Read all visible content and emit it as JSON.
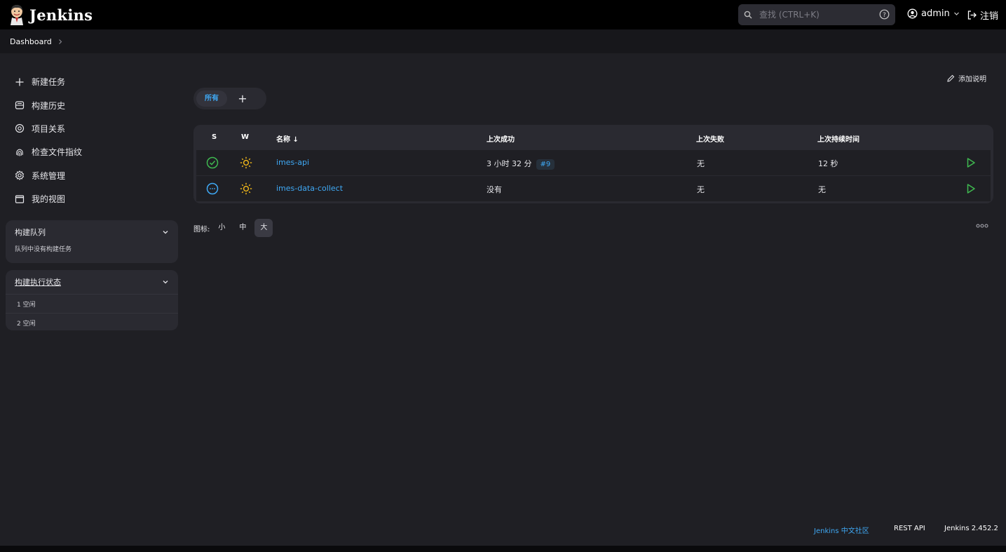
{
  "header": {
    "logo_text": "Jenkins",
    "search_placeholder": "查找 (CTRL+K)",
    "user": "admin",
    "logout": "注销"
  },
  "breadcrumb": {
    "items": [
      "Dashboard"
    ]
  },
  "nav": {
    "items": [
      {
        "label": "新建任务",
        "icon": "plus-icon"
      },
      {
        "label": "构建历史",
        "icon": "history-icon"
      },
      {
        "label": "项目关系",
        "icon": "relations-icon"
      },
      {
        "label": "检查文件指纹",
        "icon": "fingerprint-icon"
      },
      {
        "label": "系统管理",
        "icon": "gear-icon"
      },
      {
        "label": "我的视图",
        "icon": "window-icon"
      }
    ]
  },
  "build_queue": {
    "title": "构建队列",
    "empty_text": "队列中没有构建任务"
  },
  "executors": {
    "title": "构建执行状态",
    "rows": [
      "1  空闲",
      "2  空闲"
    ]
  },
  "main": {
    "add_description": "添加说明",
    "views": {
      "active": "所有",
      "add_label": "+"
    },
    "table": {
      "columns": {
        "s": "S",
        "w": "W",
        "name": "名称 ↓",
        "last_success": "上次成功",
        "last_failure": "上次失败",
        "last_duration": "上次持续时间"
      },
      "rows": [
        {
          "status": "success",
          "weather": "sunny",
          "name": "imes-api",
          "last_success": "3 小时 32 分",
          "build": "#9",
          "last_failure": "无",
          "duration": "12 秒"
        },
        {
          "status": "not-built",
          "weather": "sunny",
          "name": "imes-data-collect",
          "last_success": "没有",
          "build": "",
          "last_failure": "无",
          "duration": "无"
        }
      ]
    },
    "icon_size": {
      "label": "图标:",
      "options": [
        "小",
        "中",
        "大"
      ],
      "selected": "大"
    }
  },
  "footer": {
    "community": "Jenkins 中文社区",
    "rest_api": "REST API",
    "version": "Jenkins 2.452.2"
  },
  "colors": {
    "accent": "#3fa9f5",
    "success": "#3fb950",
    "weather": "#f2b91a",
    "run": "#3fb950"
  }
}
